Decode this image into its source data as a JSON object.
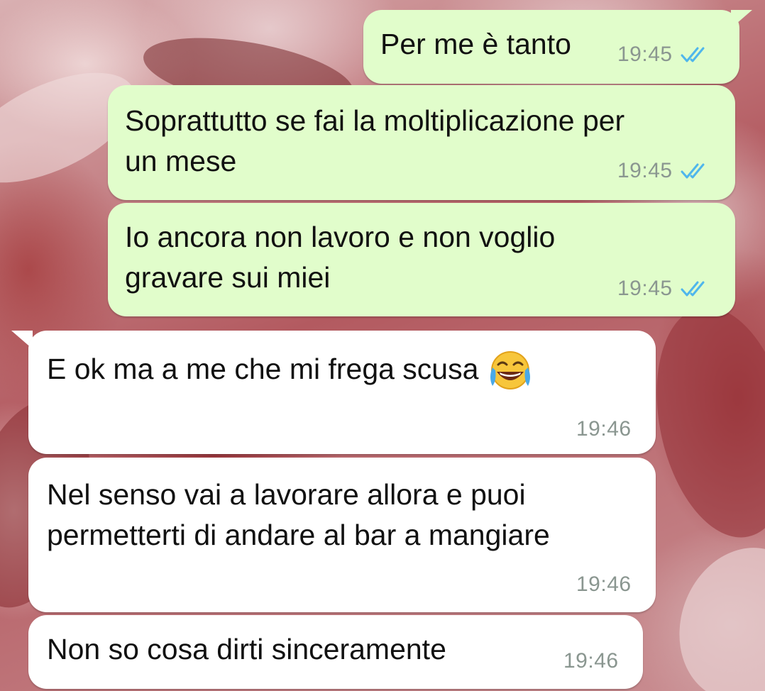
{
  "chat": {
    "messages": [
      {
        "direction": "outgoing",
        "lines": [
          "Per me è tanto"
        ],
        "time": "19:45",
        "status": "read-ticks-icon"
      },
      {
        "direction": "outgoing",
        "lines": [
          "Soprattutto se fai la moltiplicazione per",
          "un mese"
        ],
        "time": "19:45",
        "status": "read-ticks-icon"
      },
      {
        "direction": "outgoing",
        "lines": [
          "Io ancora non lavoro e non voglio",
          "gravare sui miei"
        ],
        "time": "19:45",
        "status": "read-ticks-icon"
      },
      {
        "direction": "incoming",
        "lines": [
          "E ok ma a me che mi frega scusa"
        ],
        "emoji": "face-with-tears-of-joy-icon",
        "time": "19:46"
      },
      {
        "direction": "incoming",
        "lines": [
          "Nel senso vai a lavorare allora e puoi",
          "permetterti di andare al bar a mangiare"
        ],
        "time": "19:46"
      },
      {
        "direction": "incoming",
        "lines": [
          "Non so cosa dirti sinceramente"
        ],
        "time": "19:46"
      }
    ]
  },
  "colors": {
    "outgoing_bubble": "#e1fdcb",
    "incoming_bubble": "#ffffff",
    "read_ticks": "#4fb6ec",
    "timestamp": "#8a9690"
  }
}
